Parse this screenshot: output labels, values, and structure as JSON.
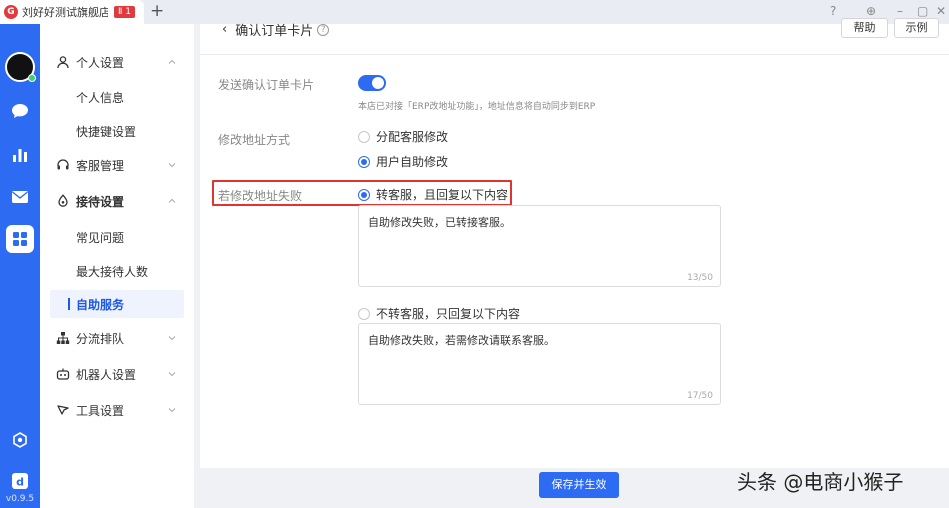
{
  "titlebar": {
    "logo_text": "G",
    "tab_title": "刘好好测试旗舰店",
    "tab_badge": "Ⅱ 1",
    "add_tab": "+",
    "controls": [
      "?",
      "⊕",
      "–",
      "▢",
      "✕"
    ]
  },
  "rail": {
    "icons": [
      "chat-icon",
      "chart-icon",
      "mail-icon",
      "apps-icon",
      "settings-icon",
      "logo-icon"
    ],
    "version": "v0.9.5",
    "brand_color": "#2d6bf2"
  },
  "sidebar": {
    "items": [
      {
        "label": "个人设置",
        "icon": "user-icon",
        "expanded": true,
        "children": [
          "个人信息",
          "快捷键设置"
        ]
      },
      {
        "label": "客服管理",
        "icon": "headset-icon",
        "expanded": false
      },
      {
        "label": "接待设置",
        "icon": "reception-icon",
        "expanded": true,
        "children": [
          "常见问题",
          "最大接待人数",
          "自助服务"
        ]
      },
      {
        "label": "分流排队",
        "icon": "org-icon",
        "expanded": false
      },
      {
        "label": "机器人设置",
        "icon": "robot-icon",
        "expanded": false
      },
      {
        "label": "工具设置",
        "icon": "tool-icon",
        "expanded": false
      }
    ],
    "active_child": "自助服务"
  },
  "page": {
    "back": "‹",
    "title": "确认订单卡片",
    "help_icon": "?",
    "help_button": "帮助",
    "example_button": "示例"
  },
  "form": {
    "send_card_label": "发送确认订单卡片",
    "send_card_enabled": true,
    "erp_hint": "本店已对接「ERP改地址功能」，地址信息将自动同步到ERP",
    "modify_method_label": "修改地址方式",
    "modify_options": [
      {
        "label": "分配客服修改",
        "checked": false
      },
      {
        "label": "用户自助修改",
        "checked": true
      }
    ],
    "fail_label": "若修改地址失败",
    "fail_options": [
      {
        "label": "转客服，且回复以下内容",
        "checked": true,
        "reply": "自助修改失败，已转接客服。",
        "count": "13/50"
      },
      {
        "label": "不转客服，只回复以下内容",
        "checked": false,
        "reply": "自助修改失败，若需修改请联系客服。",
        "count": "17/50"
      }
    ]
  },
  "footer": {
    "save_button": "保存并生效"
  },
  "watermark": "头条 @电商小猴子"
}
